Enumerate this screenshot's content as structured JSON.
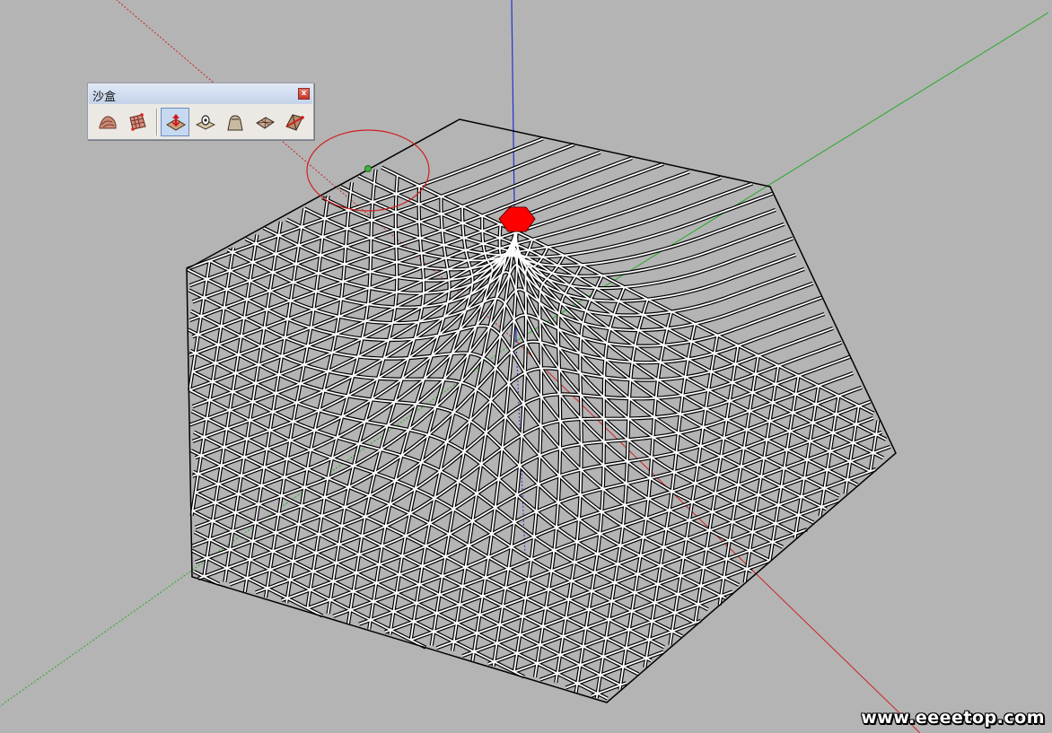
{
  "toolbar": {
    "title": "沙盒",
    "close_label": "x",
    "tools": [
      {
        "name": "from-contours-tool",
        "icon": "terrain-contours-icon",
        "active": false
      },
      {
        "name": "from-scratch-tool",
        "icon": "terrain-grid-icon",
        "active": false
      },
      {
        "name": "smoove-tool",
        "icon": "smoove-arrow-icon",
        "active": true
      },
      {
        "name": "stamp-tool",
        "icon": "stamp-icon",
        "active": false
      },
      {
        "name": "drape-tool",
        "icon": "drape-icon",
        "active": false
      },
      {
        "name": "add-detail-tool",
        "icon": "add-detail-icon",
        "active": false
      },
      {
        "name": "flip-edge-tool",
        "icon": "flip-edge-icon",
        "active": false
      }
    ]
  },
  "watermark": "www.eeeetop.com",
  "colors": {
    "background": "#b4b4b4",
    "axis_red": "#cc2222",
    "axis_green": "#22aa22",
    "axis_blue": "#2233cc",
    "mesh_edge": "#000000",
    "mesh_face": "#ffffff",
    "selected_apex": "#ff0000",
    "brush_circle": "#d02020"
  }
}
